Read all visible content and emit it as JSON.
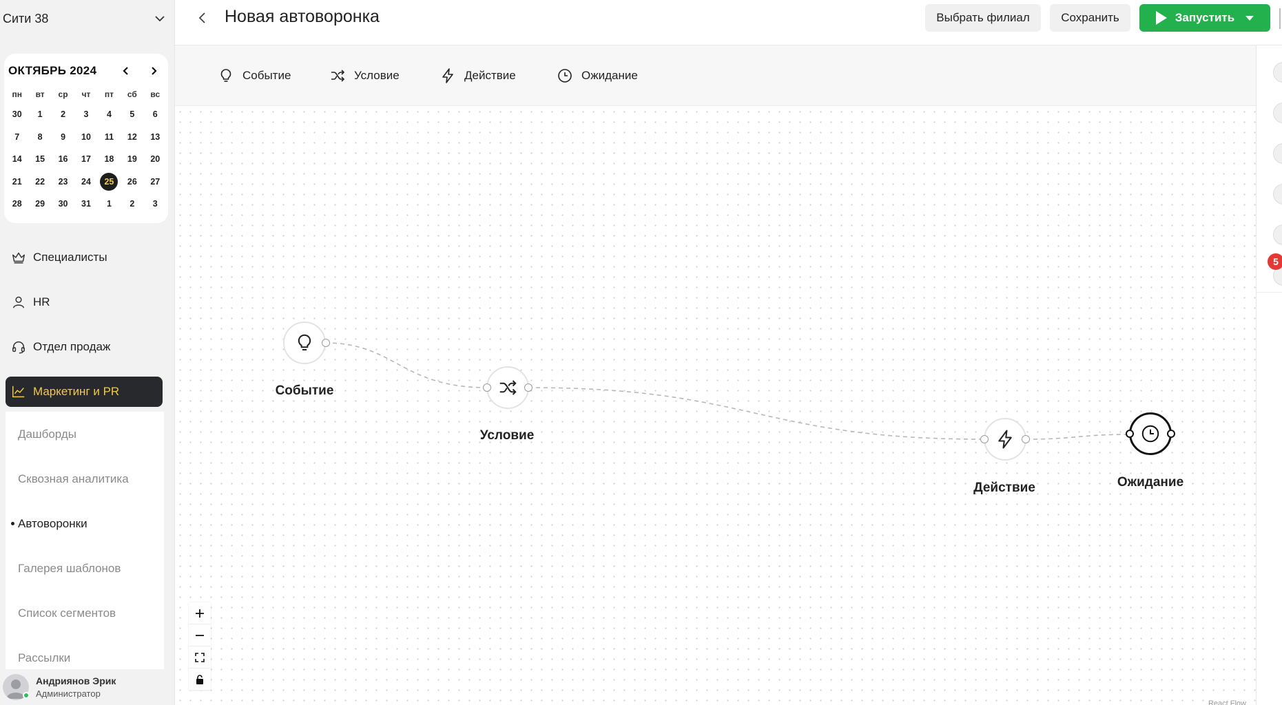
{
  "sidebar": {
    "branch_name": "Сити 38",
    "calendar": {
      "title": "ОКТЯБРЬ 2024",
      "weekdays": [
        "пн",
        "вт",
        "ср",
        "чт",
        "пт",
        "сб",
        "вс"
      ],
      "weeks": [
        [
          "30",
          "1",
          "2",
          "3",
          "4",
          "5",
          "6"
        ],
        [
          "7",
          "8",
          "9",
          "10",
          "11",
          "12",
          "13"
        ],
        [
          "14",
          "15",
          "16",
          "17",
          "18",
          "19",
          "20"
        ],
        [
          "21",
          "22",
          "23",
          "24",
          "25",
          "26",
          "27"
        ],
        [
          "28",
          "29",
          "30",
          "31",
          "1",
          "2",
          "3"
        ]
      ],
      "today": "25"
    },
    "nav": [
      {
        "label": "Специалисты",
        "icon": "crown-icon"
      },
      {
        "label": "HR",
        "icon": "user-icon"
      },
      {
        "label": "Отдел продаж",
        "icon": "headset-icon"
      },
      {
        "label": "Маркетинг и PR",
        "icon": "chart-line-icon",
        "active": true
      }
    ],
    "subnav": [
      {
        "label": "Дашборды"
      },
      {
        "label": "Сквозная аналитика"
      },
      {
        "label": "Автоворонки",
        "current": true
      },
      {
        "label": "Галерея шаблонов"
      },
      {
        "label": "Список сегментов"
      },
      {
        "label": "Рассылки"
      }
    ],
    "user": {
      "name": "Андриянов Эрик",
      "role": "Администратор"
    }
  },
  "header": {
    "title": "Новая автоворонка",
    "select_branch_label": "Выбрать филиал",
    "save_label": "Сохранить",
    "run_label": "Запустить"
  },
  "palette": {
    "items": [
      {
        "label": "Событие",
        "icon": "lightbulb-icon"
      },
      {
        "label": "Условие",
        "icon": "shuffle-icon"
      },
      {
        "label": "Действие",
        "icon": "lightning-icon"
      },
      {
        "label": "Ожидание",
        "icon": "clock-icon"
      }
    ]
  },
  "flow": {
    "nodes": [
      {
        "label": "Событие",
        "icon": "lightbulb-icon"
      },
      {
        "label": "Условие",
        "icon": "shuffle-icon"
      },
      {
        "label": "Действие",
        "icon": "lightning-icon"
      },
      {
        "label": "Ожидание",
        "icon": "clock-icon",
        "selected": true
      }
    ],
    "edges": [
      [
        "Событие",
        "Условие"
      ],
      [
        "Условие",
        "Действие"
      ],
      [
        "Действие",
        "Ожидание"
      ]
    ],
    "attribution": "React Flow"
  },
  "right_rail": {
    "badge_count": "5"
  },
  "colors": {
    "accent_green": "#22b14c",
    "accent_yellow": "#f2c94c",
    "dark": "#27292c",
    "badge_red": "#e53935"
  }
}
